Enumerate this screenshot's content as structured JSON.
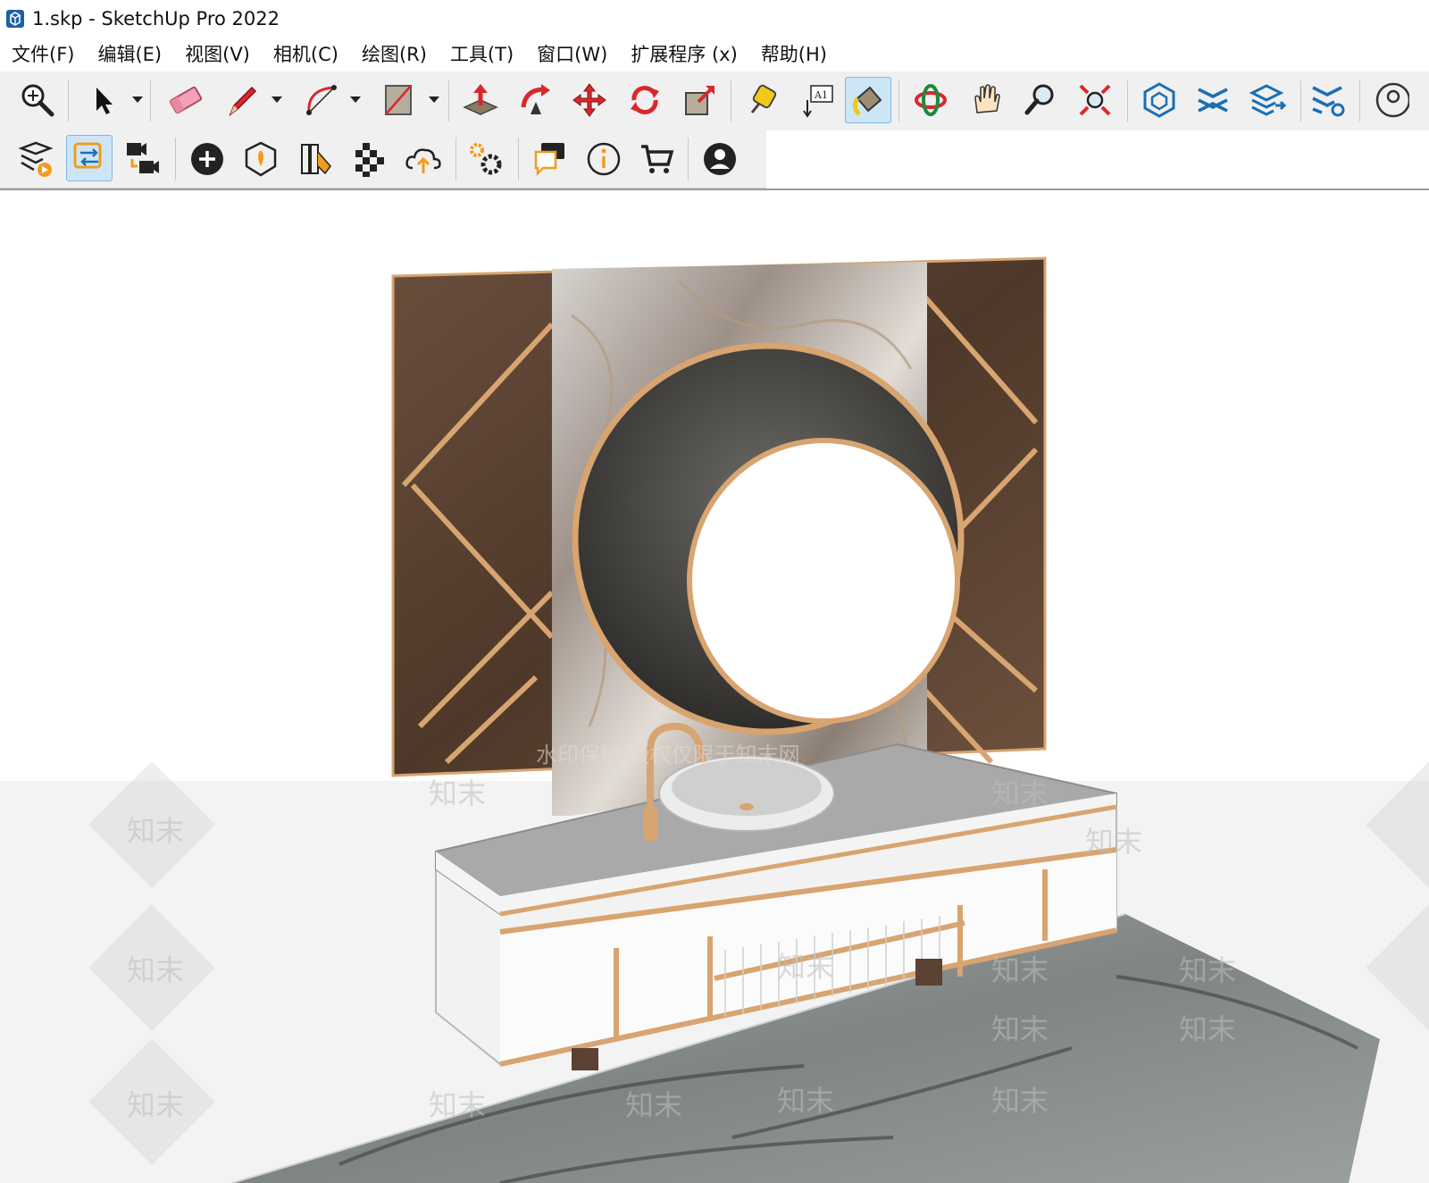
{
  "window": {
    "title": "1.skp - SketchUp Pro 2022"
  },
  "menu": [
    "文件(F)",
    "编辑(E)",
    "视图(V)",
    "相机(C)",
    "绘图(R)",
    "工具(T)",
    "窗口(W)",
    "扩展程序 (x)",
    "帮助(H)"
  ],
  "toolbar1": {
    "tools": [
      "zoom-extents-icon",
      "select-icon",
      "eraser-icon",
      "pencil-line-icon",
      "arc-icon",
      "rectangle-icon",
      "push-pull-icon",
      "follow-me-icon",
      "move-icon",
      "rotate-icon",
      "scale-icon",
      "tape-measure-icon",
      "text-label-icon",
      "paint-bucket-icon",
      "orbit-icon",
      "pan-icon",
      "zoom-icon",
      "zoom-window-icon",
      "warehouse-icon",
      "section-plane-icon",
      "layers-export-icon",
      "settings-ext-icon",
      "account-icon"
    ],
    "active": "paint-bucket-icon"
  },
  "toolbar2": {
    "tools": [
      "layout-send-icon",
      "switch-view-icon",
      "scenes-video-icon",
      "add-circle-icon",
      "shield-location-icon",
      "material-palette-icon",
      "checker-pattern-icon",
      "cloud-upload-icon",
      "gear-cluster-icon",
      "chat-bubbles-icon",
      "info-icon",
      "cart-icon",
      "user-icon"
    ],
    "active": "switch-view-icon"
  },
  "colors": {
    "accent": "#1b6fb3",
    "active_bg": "#cde6f7",
    "wood": "#5b4233",
    "trim": "#d8a470",
    "marble_dark": "#3a3a3a",
    "floor": "#8f9493"
  },
  "watermark": {
    "text": "知末",
    "caption": "水印保护 版权仅限于知末网"
  }
}
